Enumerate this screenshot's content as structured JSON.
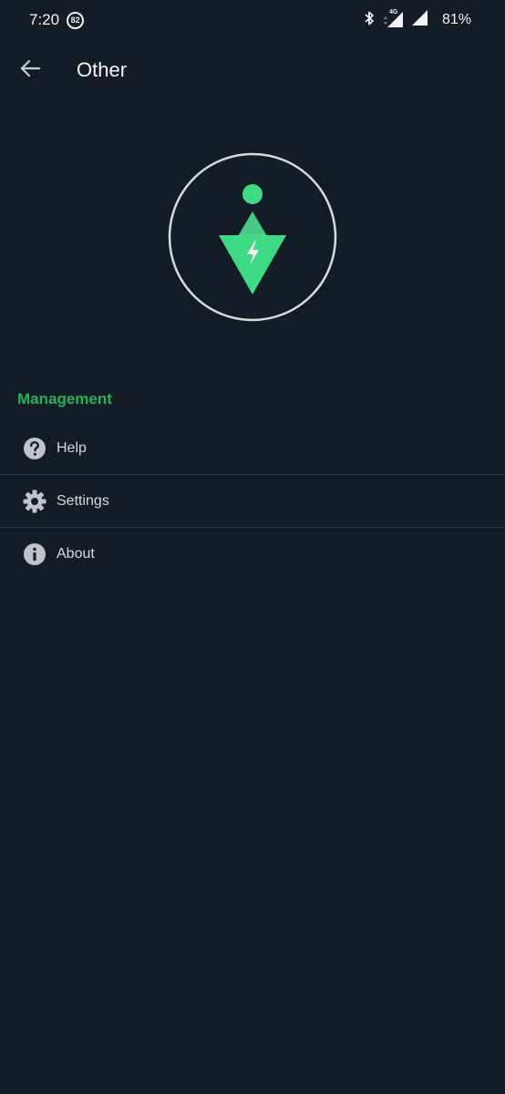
{
  "status_bar": {
    "time": "7:20",
    "notification_badge": "82",
    "network": "4G",
    "battery": "81%"
  },
  "app_bar": {
    "title": "Other",
    "back_icon": "arrow-left-icon"
  },
  "logo": {
    "icon": "app-logo",
    "accent_color": "#3ddc84"
  },
  "section": {
    "title": "Management",
    "color": "#22b45a"
  },
  "menu": {
    "items": [
      {
        "label": "Help",
        "icon": "help-circle-icon"
      },
      {
        "label": "Settings",
        "icon": "gear-icon"
      },
      {
        "label": "About",
        "icon": "info-circle-icon"
      }
    ]
  }
}
